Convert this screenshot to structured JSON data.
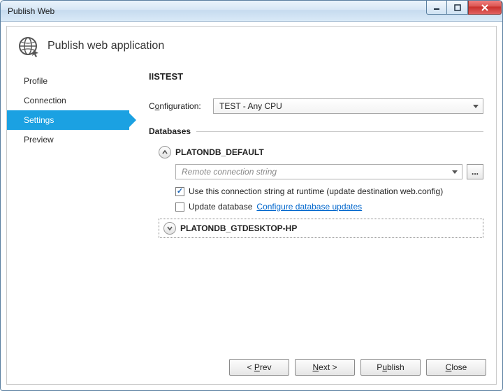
{
  "titlebar": {
    "title": "Publish Web"
  },
  "header": {
    "title": "Publish web application"
  },
  "sidebar": {
    "items": [
      {
        "label": "Profile"
      },
      {
        "label": "Connection"
      },
      {
        "label": "Settings"
      },
      {
        "label": "Preview"
      }
    ],
    "selected_index": 2
  },
  "main": {
    "profile_name": "IISTEST",
    "configuration": {
      "label_pre": "C",
      "label_under": "o",
      "label_post": "nfiguration:",
      "value": "TEST - Any CPU"
    },
    "databases_section_label": "Databases",
    "db1": {
      "name": "PLATONDB_DEFAULT",
      "conn_placeholder": "Remote connection string",
      "use_runtime_checked": true,
      "use_runtime_label": "Use this connection string at runtime (update destination web.config)",
      "update_db_checked": false,
      "update_db_label": "Update database",
      "configure_link": "Configure database updates"
    },
    "db2": {
      "name": "PLATONDB_GTDESKTOP-HP"
    }
  },
  "footer": {
    "prev": "< Prev",
    "next": "Next >",
    "publish": "Publish",
    "close": "Close",
    "prev_under": "P",
    "next_under": "N",
    "publish_under": "u",
    "close_under": "C"
  }
}
